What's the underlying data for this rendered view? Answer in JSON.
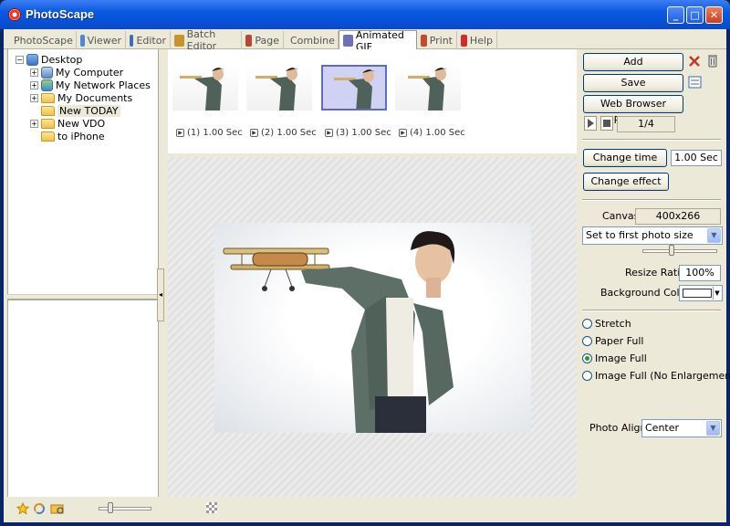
{
  "window": {
    "title": "PhotoScape",
    "controls": {
      "minimize": "_",
      "maximize": "□",
      "close": "✕"
    }
  },
  "tabs": [
    {
      "label": "PhotoScape",
      "icon": "photoscape-icon",
      "color": "#d9462a"
    },
    {
      "label": "Viewer",
      "icon": "viewer-icon",
      "color": "#4a8ad6"
    },
    {
      "label": "Editor",
      "icon": "editor-icon",
      "color": "#3f6db8"
    },
    {
      "label": "Batch Editor",
      "icon": "batch-editor-icon",
      "color": "#c9932c"
    },
    {
      "label": "Page",
      "icon": "page-icon",
      "color": "#b04b3a"
    },
    {
      "label": "Combine",
      "icon": "combine-icon",
      "color": "#5f8bc2"
    },
    {
      "label": "Animated GIF",
      "icon": "animated-gif-icon",
      "color": "#6f6fb8",
      "active": true
    },
    {
      "label": "Print",
      "icon": "print-icon",
      "color": "#c44a2f"
    },
    {
      "label": "Help",
      "icon": "help-icon",
      "color": "#d42a2a"
    }
  ],
  "tree": {
    "root": "Desktop",
    "items": [
      {
        "label": "My Computer",
        "expandable": true
      },
      {
        "label": "My Network Places",
        "expandable": true
      },
      {
        "label": "My Documents",
        "expandable": true
      },
      {
        "label": "New TODAY",
        "expandable": false,
        "selected": true
      },
      {
        "label": "New VDO",
        "expandable": true
      },
      {
        "label": "to iPhone",
        "expandable": false
      }
    ],
    "plus": "+",
    "minus": "−"
  },
  "frames": [
    {
      "label": "(1) 1.00 Sec"
    },
    {
      "label": "(2) 1.00 Sec"
    },
    {
      "label": "(3) 1.00 Sec",
      "selected": true
    },
    {
      "label": "(4) 1.00 Sec"
    }
  ],
  "controls": {
    "add": "Add",
    "save": "Save",
    "web_preview": "Web Browser Preview",
    "frame_counter": "1/4",
    "change_time": "Change time",
    "time_value": "1.00 Sec",
    "change_effect": "Change effect",
    "canvas_label": "Canvas",
    "canvas_size": "400x266",
    "size_option": "Set to first photo size",
    "resize_label": "Resize Ratio",
    "resize_value": "100%",
    "bg_label": "Background Color",
    "bg_color": "#ffffff",
    "fit_options": [
      {
        "label": "Stretch",
        "checked": false
      },
      {
        "label": "Paper Full",
        "checked": false
      },
      {
        "label": "Image Full",
        "checked": true
      },
      {
        "label": "Image Full (No Enlargement)",
        "checked": false
      }
    ],
    "align_label": "Photo Align",
    "align_value": "Center",
    "ratio_slider": 0.38
  },
  "zoom_slider": 0.2
}
